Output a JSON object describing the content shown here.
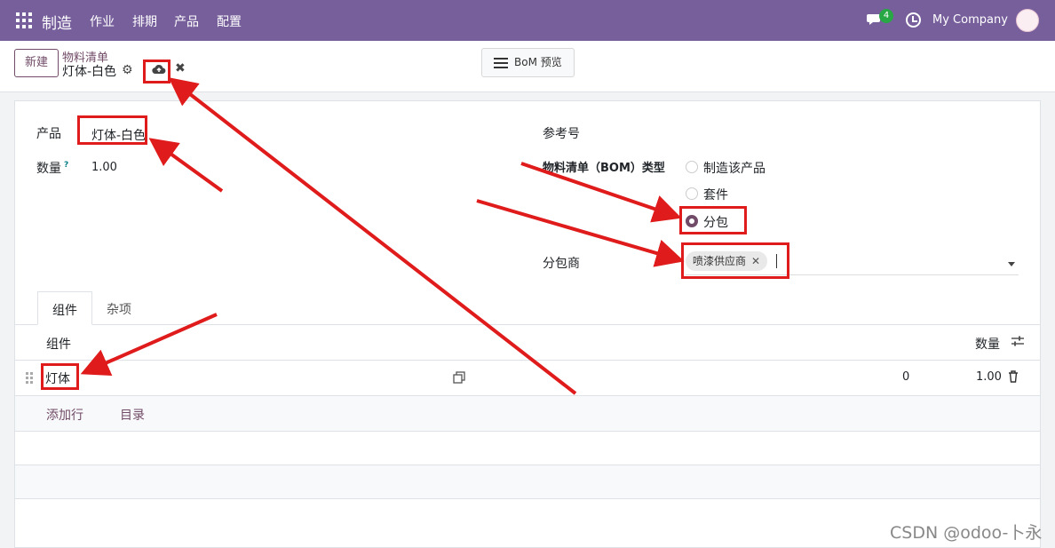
{
  "navbar": {
    "app_name": "制造",
    "menu": [
      "作业",
      "排期",
      "产品",
      "配置"
    ],
    "chat_count": "4",
    "company": "My Company"
  },
  "control_panel": {
    "new_button": "新建",
    "breadcrumb": "物料清单",
    "record_title": "灯体-白色",
    "bom_preview_button": "BoM 预览"
  },
  "form": {
    "product_label": "产品",
    "product_value": "灯体-白色",
    "quantity_label": "数量",
    "quantity_help": "?",
    "quantity_value": "1.00",
    "reference_label": "参考号",
    "bom_type_label": "物料清单（BOM）类型",
    "bom_type_options": [
      "制造该产品",
      "套件",
      "分包"
    ],
    "bom_type_selected": "分包",
    "subcontractor_label": "分包商",
    "subcontractor_tag": "喷漆供应商"
  },
  "tabs": [
    "组件",
    "杂项"
  ],
  "components_table": {
    "col_component": "组件",
    "col_quantity": "数量",
    "rows": [
      {
        "component": "灯体",
        "available": "0",
        "quantity": "1.00"
      }
    ],
    "add_line": "添加行",
    "catalog": "目录"
  },
  "watermark": "CSDN @odoo-卜永",
  "colors": {
    "navbar": "#775f9c",
    "primary": "#714b67",
    "annotation": "#e01b1b"
  }
}
